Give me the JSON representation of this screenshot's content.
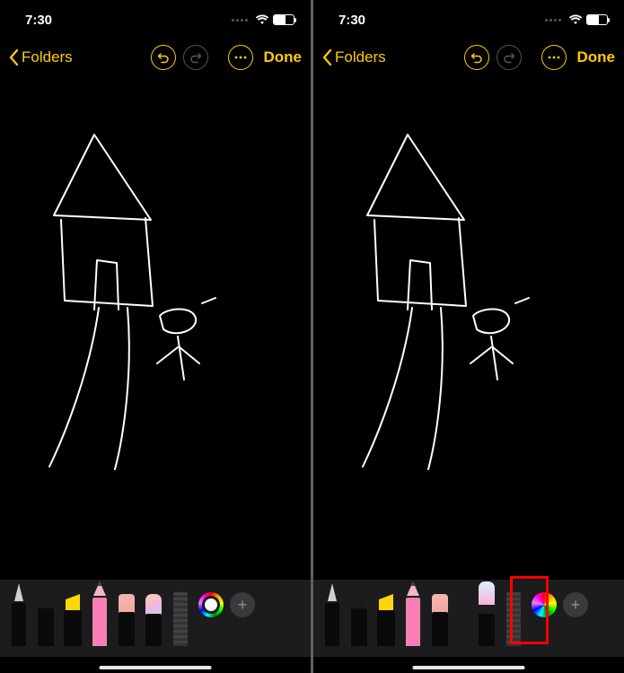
{
  "screens": [
    {
      "id": "left",
      "status": {
        "time": "7:30",
        "battery_pct": 59
      },
      "nav": {
        "back_label": "Folders",
        "done_label": "Done"
      },
      "toolset": "standard",
      "color_well_style": "ring",
      "highlight_tool": null
    },
    {
      "id": "right",
      "status": {
        "time": "7:30",
        "battery_pct": 59
      },
      "nav": {
        "back_label": "Folders",
        "done_label": "Done"
      },
      "toolset": "alt",
      "color_well_style": "solid",
      "highlight_tool": "paint"
    }
  ],
  "tools": {
    "standard": [
      "pen",
      "marker",
      "highlighter",
      "pencil",
      "eraser",
      "paint",
      "ruler"
    ],
    "alt": [
      "pen",
      "marker",
      "highlighter",
      "pencil",
      "eraser",
      "paint",
      "ruler"
    ]
  },
  "tool_labels": {
    "pen": "pen-tool",
    "marker": "marker-tool",
    "highlighter": "highlighter-tool",
    "pencil": "pencil-tool",
    "eraser": "eraser-tool",
    "paint": "paint-tool",
    "ruler": "ruler-tool"
  },
  "accent_color": "#ffcc00"
}
